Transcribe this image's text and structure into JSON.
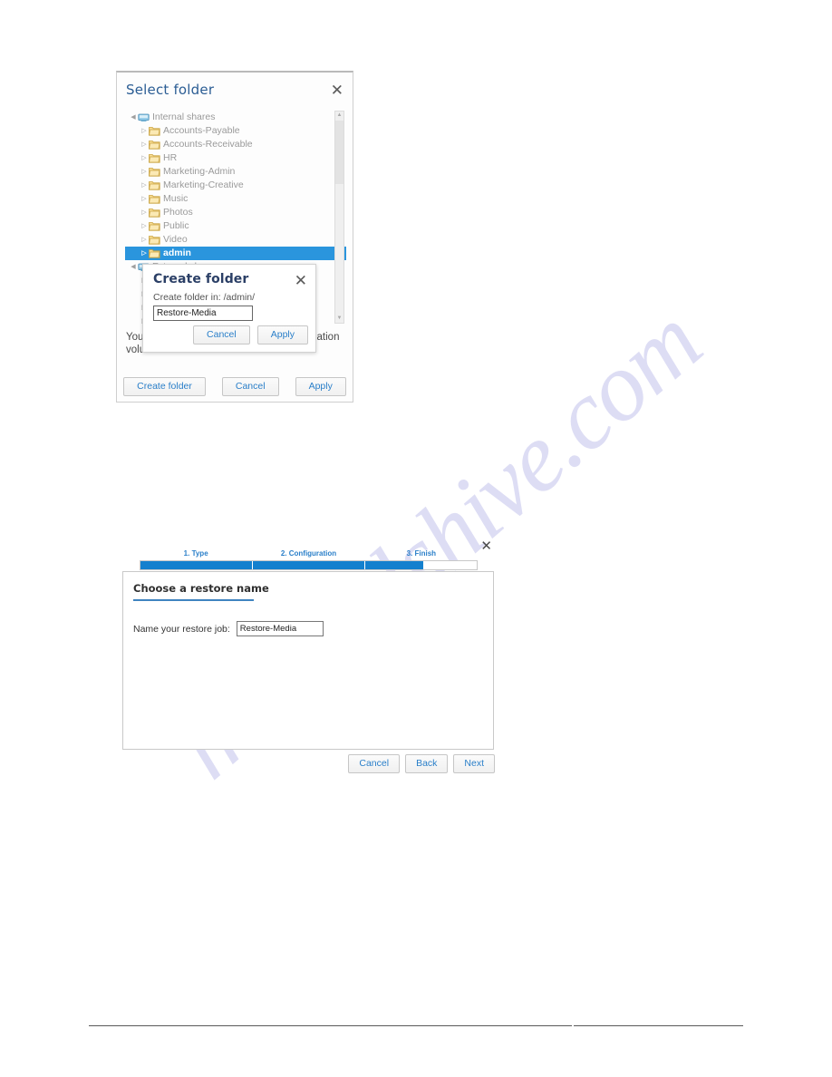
{
  "select_folder_dialog": {
    "title": "Select folder",
    "close_icon": "close-icon",
    "tree": [
      {
        "label": "Internal shares",
        "depth": 0,
        "icon": "network-share-icon",
        "twisty": "expanded",
        "selected": false
      },
      {
        "label": "Accounts-Payable",
        "depth": 1,
        "icon": "folder-icon",
        "twisty": "collapsed",
        "selected": false
      },
      {
        "label": "Accounts-Receivable",
        "depth": 1,
        "icon": "folder-icon",
        "twisty": "collapsed",
        "selected": false
      },
      {
        "label": "HR",
        "depth": 1,
        "icon": "folder-icon",
        "twisty": "collapsed",
        "selected": false
      },
      {
        "label": "Marketing-Admin",
        "depth": 1,
        "icon": "folder-icon",
        "twisty": "collapsed",
        "selected": false
      },
      {
        "label": "Marketing-Creative",
        "depth": 1,
        "icon": "folder-icon",
        "twisty": "collapsed",
        "selected": false
      },
      {
        "label": "Music",
        "depth": 1,
        "icon": "folder-icon",
        "twisty": "collapsed",
        "selected": false
      },
      {
        "label": "Photos",
        "depth": 1,
        "icon": "folder-icon",
        "twisty": "collapsed",
        "selected": false
      },
      {
        "label": "Public",
        "depth": 1,
        "icon": "folder-icon",
        "twisty": "collapsed",
        "selected": false
      },
      {
        "label": "Video",
        "depth": 1,
        "icon": "folder-icon",
        "twisty": "collapsed",
        "selected": false
      },
      {
        "label": "admin",
        "depth": 1,
        "icon": "folder-icon",
        "twisty": "collapsed",
        "selected": true
      },
      {
        "label": "External shares",
        "depth": 0,
        "icon": "network-share-icon",
        "twisty": "expanded",
        "selected": false
      },
      {
        "label": "",
        "depth": 1,
        "icon": "folder-icon",
        "twisty": "collapsed",
        "selected": false
      },
      {
        "label": "",
        "depth": 1,
        "icon": "folder-icon",
        "twisty": "collapsed",
        "selected": false
      },
      {
        "label": "",
        "depth": 1,
        "icon": "folder-icon",
        "twisty": "collapsed",
        "selected": false
      },
      {
        "label": "",
        "depth": 1,
        "icon": "folder-icon",
        "twisty": "collapsed",
        "selected": false
      },
      {
        "label": "",
        "depth": 1,
        "icon": "folder-icon",
        "twisty": "collapsed",
        "selected": false
      }
    ],
    "note": "You are allowed to write into those Destination volumes.",
    "buttons": {
      "create_folder": "Create folder",
      "cancel": "Cancel",
      "apply": "Apply"
    },
    "scrollbar": {
      "up_arrow_icon": "chevron-up-icon",
      "down_arrow_icon": "chevron-down-icon"
    }
  },
  "create_folder_modal": {
    "title": "Create folder",
    "close_icon": "close-icon",
    "subtitle": "Create folder in: /admin/",
    "input_value": "Restore-Media",
    "input_placeholder": "",
    "buttons": {
      "cancel": "Cancel",
      "apply": "Apply"
    }
  },
  "restore_wizard": {
    "close_icon": "close-icon",
    "steps": [
      {
        "label": "1. Type",
        "fill_percent": 100
      },
      {
        "label": "2. Configuration",
        "fill_percent": 100
      },
      {
        "label": "3. Finish",
        "fill_percent": 52
      }
    ],
    "section_title": "Choose a restore name",
    "field_label": "Name your restore job:",
    "input_value": "Restore-Media",
    "input_placeholder": "",
    "buttons": {
      "cancel": "Cancel",
      "back": "Back",
      "next": "Next"
    }
  },
  "watermark": {
    "text": "manualshive.com"
  },
  "colors": {
    "accent_blue": "#2a7fc9",
    "progress_blue": "#1480ce",
    "selection_blue": "#2a95dd",
    "title_blue": "#2b5d94",
    "folder_yellow": "#f6d67b",
    "watermark": "#c9c9ee"
  }
}
